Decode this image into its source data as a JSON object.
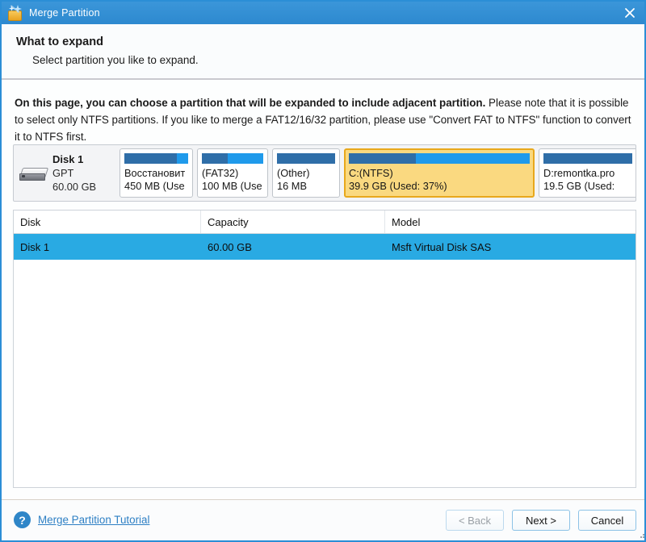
{
  "window": {
    "title": "Merge Partition",
    "icon": "wand-partition-icon",
    "close_label": "✕"
  },
  "header": {
    "title": "What to expand",
    "subtitle": "Select partition you like to expand."
  },
  "body": {
    "intro_bold": "On this page, you can choose a partition that will be expanded to include adjacent partition.",
    "intro_rest": " Please note that it is possible to select only NTFS partitions. If you like to merge a FAT12/16/32 partition, please use \"Convert FAT to NTFS\" function to convert it to NTFS first."
  },
  "disk_map": {
    "disk_name": "Disk 1",
    "disk_scheme": "GPT",
    "disk_size": "60.00 GB",
    "partitions": [
      {
        "name": "Восстановит",
        "size_text": "450 MB (Use",
        "used_percent": 82,
        "selected": false
      },
      {
        "name": "(FAT32)",
        "size_text": "100 MB (Use",
        "used_percent": 42,
        "selected": false
      },
      {
        "name": "(Other)",
        "size_text": "16 MB",
        "used_percent": 100,
        "selected": false
      },
      {
        "name": "C:(NTFS)",
        "size_text": "39.9 GB (Used: 37%)",
        "used_percent": 37,
        "selected": true
      },
      {
        "name": "D:remontka.pro",
        "size_text": "19.5 GB (Used:",
        "used_percent": 100,
        "selected": false
      }
    ]
  },
  "table": {
    "columns": [
      "Disk",
      "Capacity",
      "Model"
    ],
    "rows": [
      {
        "disk": "Disk 1",
        "capacity": "60.00 GB",
        "model": "Msft Virtual Disk SAS",
        "selected": true
      }
    ]
  },
  "footer": {
    "help_icon_label": "?",
    "help_link": "Merge Partition Tutorial",
    "buttons": {
      "back": "< Back",
      "next": "Next >",
      "cancel": "Cancel"
    }
  },
  "colors": {
    "titlebar": "#2d89cf",
    "accent_border": "#2b8ed6",
    "selection": "#29aae3",
    "partition_selected": "#fad980",
    "bar_used": "#2f6ea8",
    "bar_free": "#1f9aeb",
    "link": "#2d7fc4"
  }
}
